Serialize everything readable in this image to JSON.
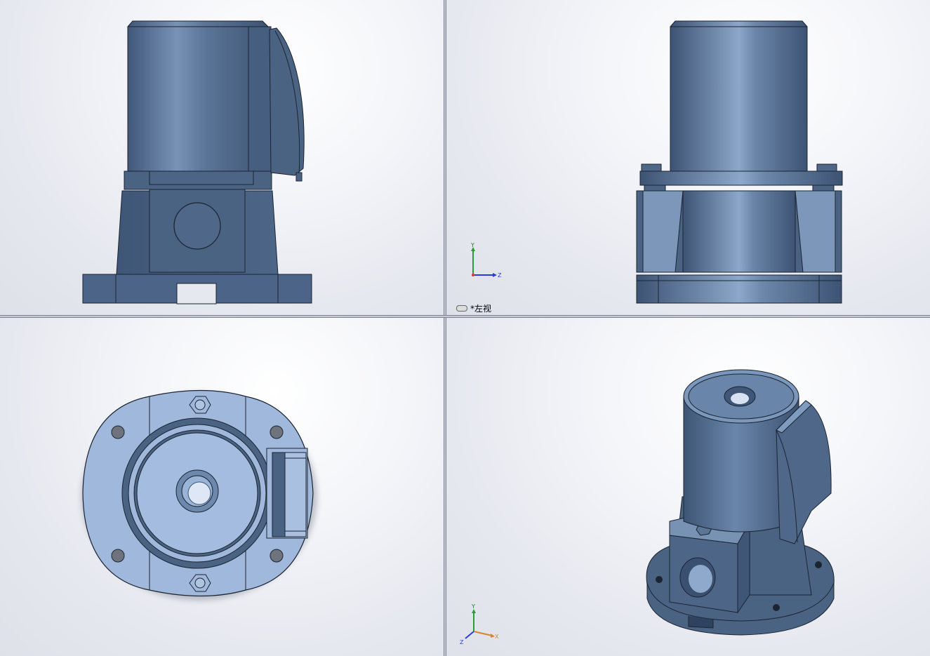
{
  "viewports": {
    "front": {
      "name": "front-view"
    },
    "left": {
      "name": "left-view",
      "label": "*左视"
    },
    "top": {
      "name": "top-view"
    },
    "iso": {
      "name": "isometric-view"
    }
  },
  "triad": {
    "x": "X",
    "y": "Y",
    "z": "Z"
  },
  "colors": {
    "body": "#4a6282",
    "body_light": "#7f9bbd",
    "body_highlight": "#a6bcd9",
    "edge": "#1b2430",
    "plan": "#9fb8dc"
  }
}
